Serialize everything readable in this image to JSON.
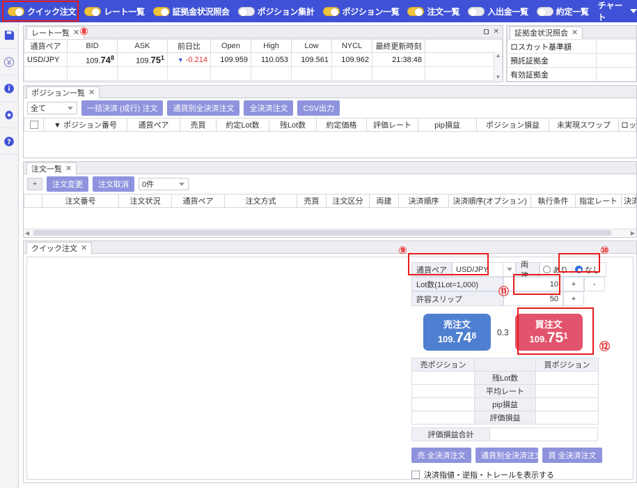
{
  "toolbar": {
    "items": [
      {
        "label": "クイック注文",
        "state": "on"
      },
      {
        "label": "レート一覧",
        "state": "on"
      },
      {
        "label": "証拠金状況照会",
        "state": "on"
      },
      {
        "label": "ポジション集計",
        "state": "off"
      },
      {
        "label": "ポジション一覧",
        "state": "on"
      },
      {
        "label": "注文一覧",
        "state": "on"
      },
      {
        "label": "入出金一覧",
        "state": "off"
      },
      {
        "label": "約定一覧",
        "state": "off"
      }
    ],
    "chart_label": "チャート"
  },
  "sidebar": {
    "items": [
      {
        "icon": "save-icon"
      },
      {
        "icon": "yen-icon"
      },
      {
        "icon": "info-icon"
      },
      {
        "icon": "gear-icon"
      },
      {
        "icon": "help-icon"
      }
    ]
  },
  "rate_panel": {
    "tab": "レート一覧",
    "close": "✕",
    "columns": [
      "通貨ペア",
      "BID",
      "ASK",
      "前日比",
      "Open",
      "High",
      "Low",
      "NYCL",
      "最終更新時刻"
    ],
    "row": {
      "pair": "USD/JPY",
      "bid_int": "109.",
      "bid_big": "74",
      "bid_sup": "8",
      "ask_int": "109.",
      "ask_big": "75",
      "ask_sup": "1",
      "change": "-0.214",
      "change_arrow": "▼",
      "open": "109.959",
      "high": "110.053",
      "low": "109.561",
      "nycl": "109.962",
      "updated": "21:38:48"
    }
  },
  "margin_panel": {
    "tab": "証拠金状況照会",
    "close": "✕",
    "rows": [
      "ロスカット基準額",
      "預託証拠金",
      "有効証拠金"
    ]
  },
  "position_panel": {
    "tab": "ポジション一覧",
    "close": "✕",
    "filter": "全て",
    "buttons": [
      "一括決済 (成行) 注文",
      "通貨別全決済注文",
      "全決済注文",
      "CSV出力"
    ],
    "columns": [
      "",
      "▼ ポジション番号",
      "通貨ペア",
      "売買",
      "約定Lot数",
      "残Lot数",
      "約定価格",
      "評価レート",
      "pip損益",
      "ポジション損益",
      "未実現スワップ",
      "ロック"
    ]
  },
  "order_panel": {
    "tab": "注文一覧",
    "close": "✕",
    "add": "+",
    "buttons": [
      "注文変更",
      "注文取消"
    ],
    "count": "0件",
    "columns": [
      "",
      "注文番号",
      "注文状況",
      "通貨ペア",
      "注文方式",
      "売買",
      "注文区分",
      "両建",
      "決済順序",
      "決済順序(オプション)",
      "執行条件",
      "指定レート",
      "決済"
    ]
  },
  "quick_order": {
    "tab": "クイック注文",
    "close": "✕",
    "pair_label": "通貨ペア",
    "pair_value": "USD/JPY",
    "hedge_label": "両建",
    "hedge_yes": "あり",
    "hedge_no": "なし",
    "hedge_selected": "なし",
    "lot_label": "Lot数(1Lot=1,000)",
    "lot_value": "10",
    "lot_plus": "+",
    "lot_minus": "-",
    "slip_label": "許容スリップ",
    "slip_value": "50",
    "slip_plus": "+",
    "sell_button": {
      "title": "売注文",
      "int": "109.",
      "big": "74",
      "sup": "8"
    },
    "buy_button": {
      "title": "買注文",
      "int": "109.",
      "big": "75",
      "sup": "1"
    },
    "spread": "0.3",
    "table": {
      "head_sell": "売ポジション",
      "head_buy": "買ポジション",
      "rows": [
        "残Lot数",
        "平均レート",
        "pip損益",
        "評価損益"
      ],
      "total_label": "評価損益合計"
    },
    "footer_buttons": [
      "売 全決済注文",
      "通貨別全決済注文",
      "買 全決済注文"
    ],
    "checkbox_label": "決済指値・逆指・トレールを表示する"
  },
  "annotations": {
    "n8": "⑧",
    "n9": "⑨",
    "n10": "⑩",
    "n11": "⑪",
    "n12": "⑫"
  },
  "colors": {
    "toolbar_bg": "#3f51d6",
    "accent_purple": "#8f93dd",
    "sell_blue": "#4f7fd0",
    "buy_red": "#e2546c",
    "highlight_red": "#e81a1a"
  }
}
